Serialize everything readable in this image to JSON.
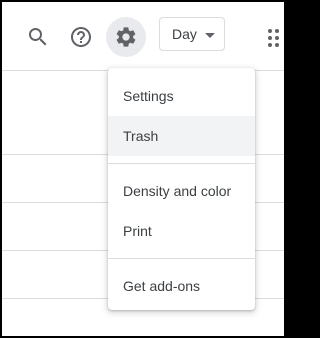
{
  "toolbar": {
    "search_icon": "search-icon",
    "help_icon": "help-icon",
    "settings_icon": "gear-icon",
    "view_selector": {
      "selected": "Day"
    },
    "apps_icon": "apps-grid-icon"
  },
  "settings_menu": {
    "items": [
      {
        "label": "Settings"
      },
      {
        "label": "Trash",
        "hovered": true
      },
      {
        "label": "Density and color"
      },
      {
        "label": "Print"
      },
      {
        "label": "Get add-ons"
      }
    ]
  },
  "colors": {
    "icon": "#5f6368",
    "text": "#3c4043",
    "divider": "#dadce0",
    "hover_bg": "#f1f3f4",
    "active_icon_bg": "#e8eaed"
  }
}
